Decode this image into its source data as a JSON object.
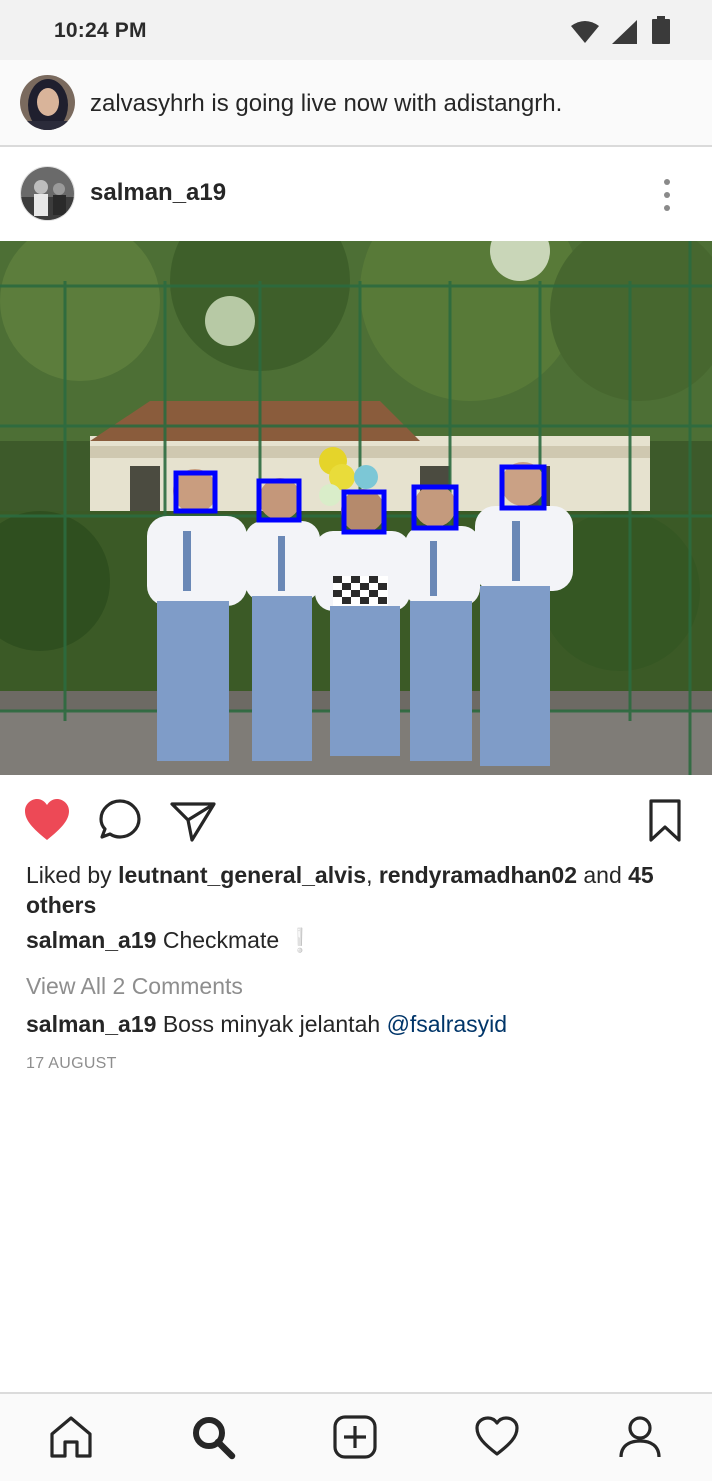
{
  "status_bar": {
    "time": "10:24 PM",
    "icons": [
      "wifi-icon",
      "signal-icon",
      "battery-icon"
    ]
  },
  "live_banner": {
    "text": "zalvasyhrh is going live now with adistangrh."
  },
  "post": {
    "username": "salman_a19",
    "image_alt": "",
    "liked": true,
    "likes": {
      "prefix": "Liked by",
      "user1": "leutnant_general_alvis",
      "separator": ",",
      "user2": "rendyramadhan02",
      "and": "and",
      "others": "45 others"
    },
    "caption": {
      "username": "salman_a19",
      "text": "Checkmate",
      "emoji": "❕"
    },
    "view_comments": "View All 2 Comments",
    "comment": {
      "username": "salman_a19",
      "text": "Boss minyak jelantah",
      "mention": "@fsalrasyid"
    },
    "date": "17 AUGUST"
  },
  "bottom_nav": {
    "items": [
      "home-icon",
      "search-icon",
      "add-post-icon",
      "activity-heart-icon",
      "profile-icon"
    ],
    "active": "search-icon"
  },
  "colors": {
    "like_red": "#ed4956",
    "mention_blue": "#003569",
    "face_box_blue": "#0000ff"
  }
}
